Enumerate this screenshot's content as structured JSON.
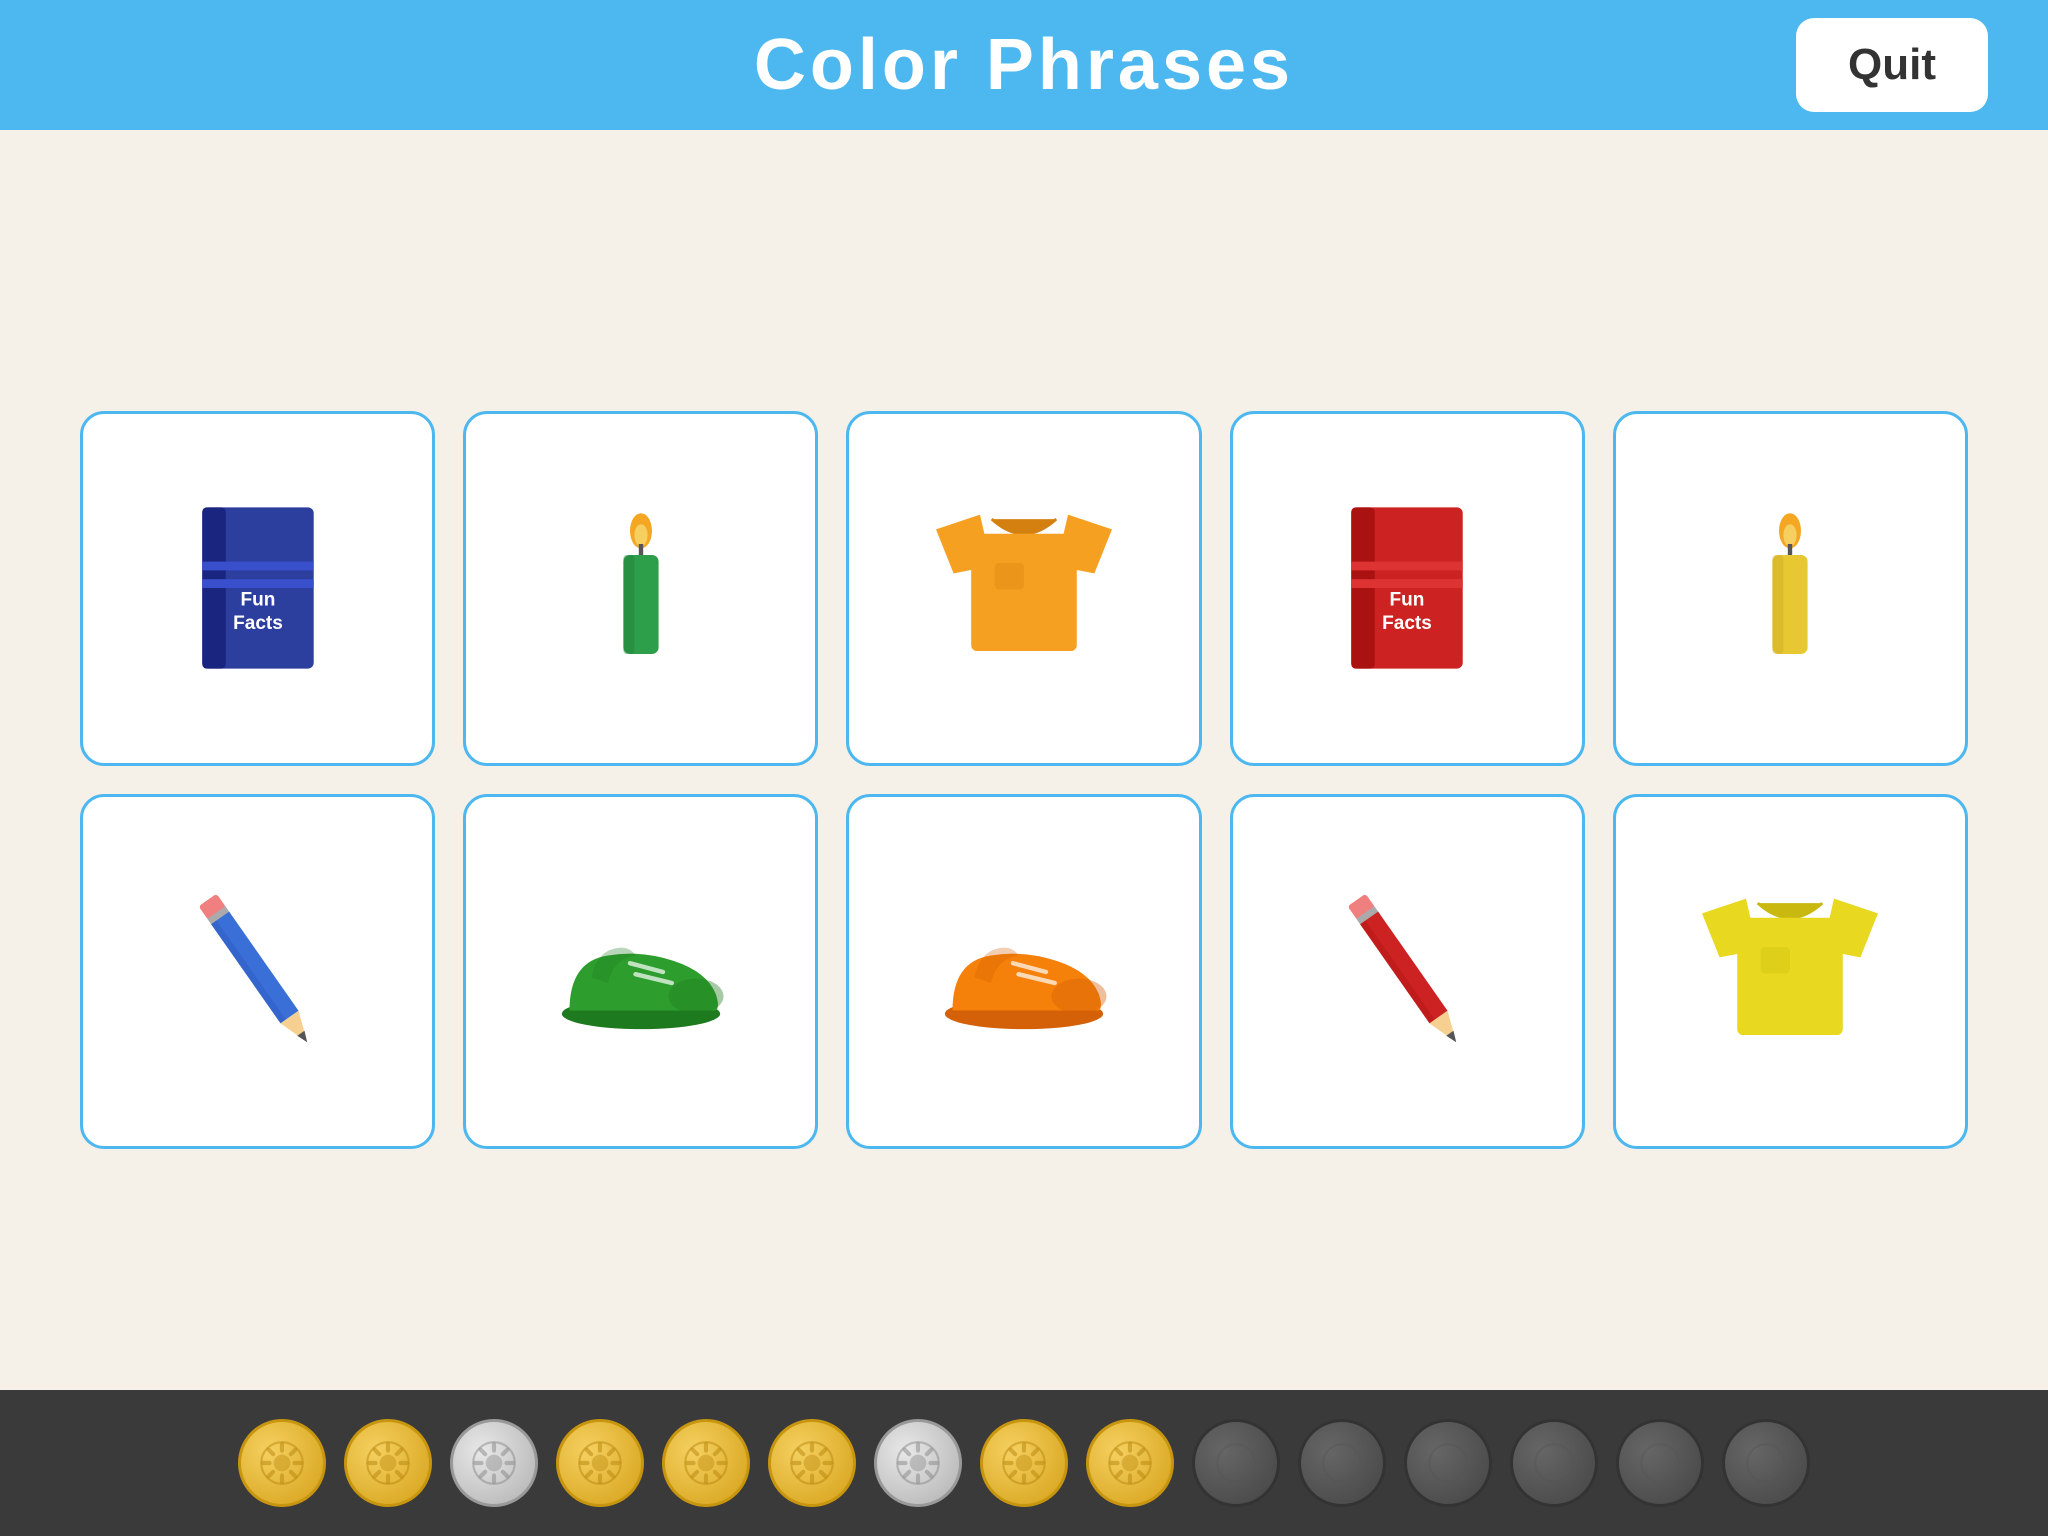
{
  "header": {
    "title": "Color  Phrases",
    "quit_label": "Quit"
  },
  "cards": [
    {
      "id": 1,
      "type": "book",
      "color": "blue",
      "label": "blue-book"
    },
    {
      "id": 2,
      "type": "candle",
      "color": "green",
      "label": "green-candle"
    },
    {
      "id": 3,
      "type": "shirt",
      "color": "orange",
      "label": "orange-shirt"
    },
    {
      "id": 4,
      "type": "book",
      "color": "red",
      "label": "red-book"
    },
    {
      "id": 5,
      "type": "candle",
      "color": "yellow",
      "label": "yellow-candle"
    },
    {
      "id": 6,
      "type": "pencil",
      "color": "blue",
      "label": "blue-pencil"
    },
    {
      "id": 7,
      "type": "shoe",
      "color": "green",
      "label": "green-shoe"
    },
    {
      "id": 8,
      "type": "shoe",
      "color": "orange",
      "label": "orange-shoe"
    },
    {
      "id": 9,
      "type": "pencil",
      "color": "red",
      "label": "red-pencil"
    },
    {
      "id": 10,
      "type": "shirt",
      "color": "yellow",
      "label": "yellow-shirt"
    }
  ],
  "bottom_bar": {
    "coins": [
      {
        "type": "gold",
        "filled": true
      },
      {
        "type": "gold",
        "filled": true
      },
      {
        "type": "silver",
        "filled": true
      },
      {
        "type": "gold",
        "filled": true
      },
      {
        "type": "gold",
        "filled": true
      },
      {
        "type": "gold",
        "filled": true
      },
      {
        "type": "silver",
        "filled": true
      },
      {
        "type": "gold",
        "filled": true
      },
      {
        "type": "gold",
        "filled": true
      },
      {
        "type": "dark",
        "filled": false
      },
      {
        "type": "dark",
        "filled": false
      },
      {
        "type": "dark",
        "filled": false
      },
      {
        "type": "dark",
        "filled": false
      },
      {
        "type": "dark",
        "filled": false
      },
      {
        "type": "dark",
        "filled": false
      }
    ]
  }
}
